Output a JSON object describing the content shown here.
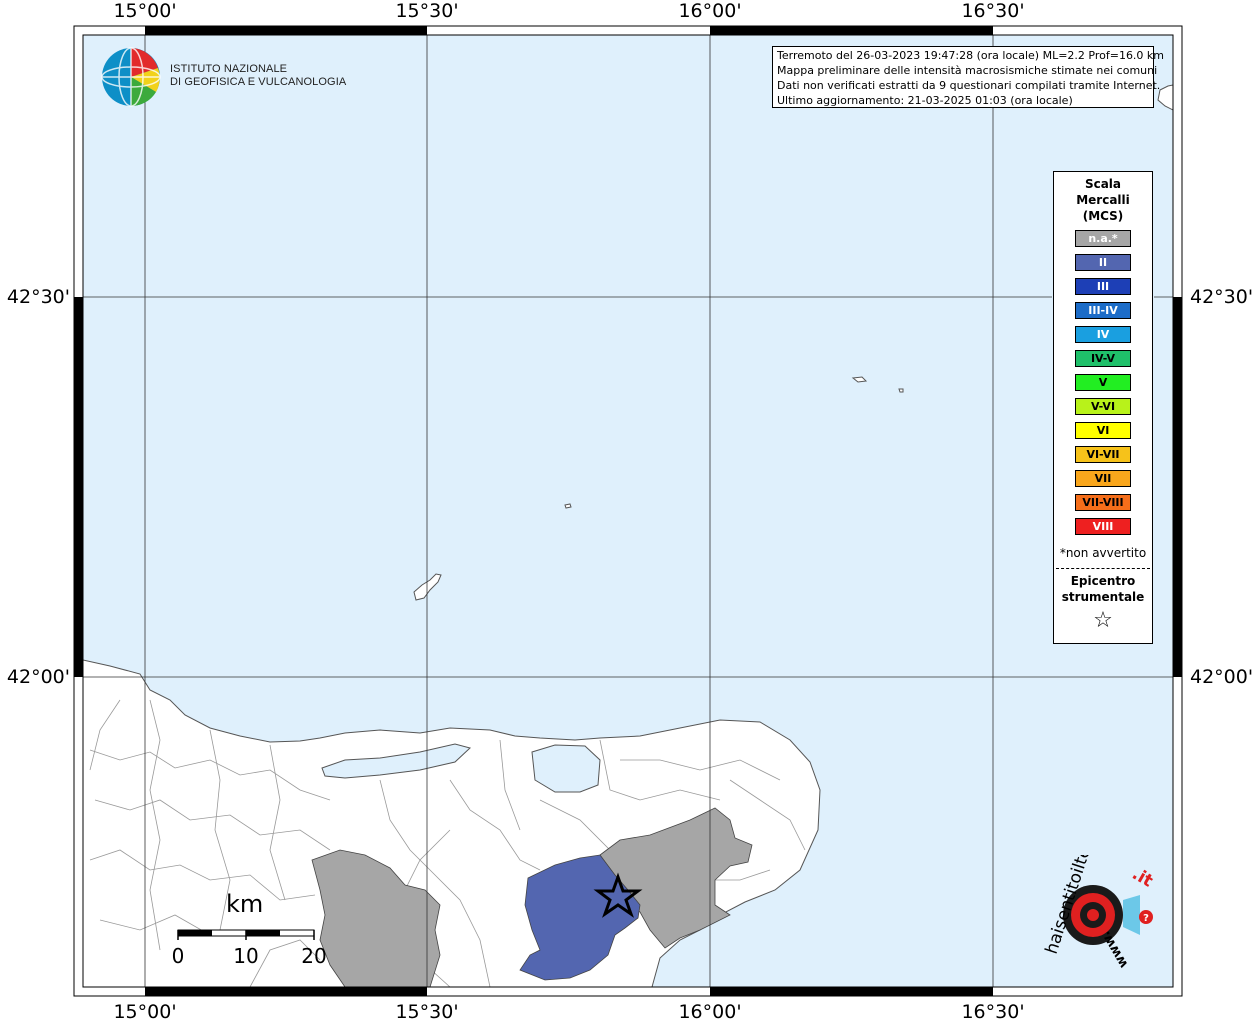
{
  "axes": {
    "top_ticks": [
      "15°00'",
      "15°30'",
      "16°00'",
      "16°30'"
    ],
    "bottom_ticks": [
      "15°00'",
      "15°30'",
      "16°00'",
      "16°30'"
    ],
    "left_ticks": [
      "42°30'",
      "42°00'"
    ],
    "right_ticks": [
      "42°30'",
      "42°00'"
    ]
  },
  "info": {
    "line1": "Terremoto del 26-03-2023 19:47:28 (ora locale) ML=2.2 Prof=16.0 km",
    "line2": "Mappa preliminare delle intensità macrosismiche stimate nei comuni",
    "line3": "Dati non verificati estratti da 9 questionari compilati tramite Internet.",
    "line4": "Ultimo aggiornamento: 21-03-2025 01:03 (ora locale)"
  },
  "legend": {
    "title_1": "Scala",
    "title_2": "Mercalli",
    "title_3": "(MCS)",
    "classes": [
      {
        "label": "n.a.*",
        "color": "#a6a6a6",
        "text_color": "#ffffff"
      },
      {
        "label": "II",
        "color": "#5366b0",
        "text_color": "#ffffff"
      },
      {
        "label": "III",
        "color": "#1d3fb6",
        "text_color": "#ffffff"
      },
      {
        "label": "III-IV",
        "color": "#1c6cc8",
        "text_color": "#ffffff"
      },
      {
        "label": "IV",
        "color": "#1a9fe0",
        "text_color": "#ffffff"
      },
      {
        "label": "IV-V",
        "color": "#1fc06a",
        "text_color": "#000000"
      },
      {
        "label": "V",
        "color": "#22ee22",
        "text_color": "#000000"
      },
      {
        "label": "V-VI",
        "color": "#b8f21a",
        "text_color": "#000000"
      },
      {
        "label": "VI",
        "color": "#ffff00",
        "text_color": "#000000"
      },
      {
        "label": "VI-VII",
        "color": "#f6c21a",
        "text_color": "#000000"
      },
      {
        "label": "VII",
        "color": "#f9a61c",
        "text_color": "#000000"
      },
      {
        "label": "VII-VIII",
        "color": "#f56e1a",
        "text_color": "#000000"
      },
      {
        "label": "VIII",
        "color": "#ee2020",
        "text_color": "#ffffff"
      }
    ],
    "note": "*non avvertito",
    "epicenter_1": "Epicentro",
    "epicenter_2": "strumentale",
    "epicenter_symbol": "☆"
  },
  "ingv": {
    "line1": "ISTITUTO NAZIONALE",
    "line2": "DI GEOFISICA E VULCANOLOGIA"
  },
  "scalebar": {
    "unit": "km",
    "labels": [
      "0",
      "10",
      "20"
    ]
  },
  "colors": {
    "sea": "#dff0fc",
    "land": "#ffffff",
    "intensity_na": "#a6a6a6",
    "intensity_ii": "#5366b0"
  },
  "branding": {
    "site_text": "haisentitoilterremoto",
    "site_tld": ".it",
    "www": "www."
  }
}
